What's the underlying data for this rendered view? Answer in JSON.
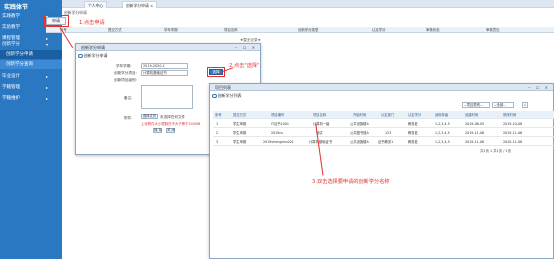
{
  "sidebar": {
    "logo": "实践体节",
    "items": [
      {
        "label": "实践教学",
        "arrow": "▾"
      },
      {
        "label": "实验教学",
        "arrow": "▸"
      },
      {
        "label": "课程管理",
        "arrow": "▸"
      },
      {
        "label": "创新学分",
        "arrow": "▾"
      },
      {
        "label": "创新学分申请"
      },
      {
        "label": "创新学分查询"
      },
      {
        "label": "毕业设计",
        "arrow": "▸"
      },
      {
        "label": "学籍管理",
        "arrow": "▸"
      },
      {
        "label": "学籍维护",
        "arrow": "▸"
      }
    ]
  },
  "topbar": {
    "tabs": [
      "个人中心",
      "创新学分申请 ×"
    ]
  },
  "breadcrumb": "创新学分申请",
  "main": {
    "apply_button": "申请",
    "columns": [
      "序号",
      "提交方式",
      "学年学期",
      "项目名称",
      "创新学分类型",
      "认定学分",
      "审核状态",
      "审核意见"
    ],
    "no_data": "★暂无记录★"
  },
  "annotations": {
    "step1": "1.点击申请",
    "step2": "2.点击\"选择\"",
    "step3": "3.双击选择要申请的创新学分名称"
  },
  "dialog1": {
    "title": "创新学分申请",
    "subtitle": "创新学分申请",
    "controls": "‒ ☐ ✕",
    "fields": {
      "term_label": "学年学期:",
      "term_value": "2019-2020-1",
      "credit_label": "创新学分项目:",
      "credit_value": "计算机基础证书",
      "select_button": "选择",
      "level_label": "创新项目级别:",
      "remark_label": "备注:",
      "attach_label": "附件:",
      "file_button": "选择文件",
      "file_status": "未选择任何文件",
      "upload_note": "上传附件大小限制在不大于等于200MB",
      "save_button": "保 存",
      "close_button": "关 闭"
    }
  },
  "dialog2": {
    "title": "项目列表",
    "subtitle": "创新学分列表",
    "controls": "‒ ☐ ✕",
    "filter1": "--项目类别--",
    "filter2": "--全部--",
    "search_icon": "search-icon",
    "headers": [
      "序号",
      "提交方式",
      "项目编号",
      "项目名称",
      "开始时间",
      "认定部门",
      "认定学分",
      "适用年级",
      "创建时间",
      "修改时间"
    ],
    "rows": [
      [
        "1",
        "学生申报",
        "IT证书1001",
        "计算机一级",
        "公共设施楼A",
        "",
        "教务处",
        "1,2,3,4,5",
        "2019-06-05",
        "2019-10-08"
      ],
      [
        "2",
        "学生申报",
        "2019cs",
        "测试",
        "公共图书馆A",
        "123",
        "教务处",
        "1,2,3,4,5",
        "2019-11-06",
        "2019-11-06"
      ],
      [
        "3",
        "学生申报",
        "2019shengchu001",
        "计算机基础证书",
        "公共设施楼A",
        "证书教务1",
        "教务处",
        "1,2,3,4,5",
        "2019-11-08",
        "2020-11-08"
      ]
    ],
    "pager": "共1页  1  共1页 / 1页"
  },
  "colors": {
    "accent": "#2b78c2",
    "annotation": "#e53030"
  }
}
